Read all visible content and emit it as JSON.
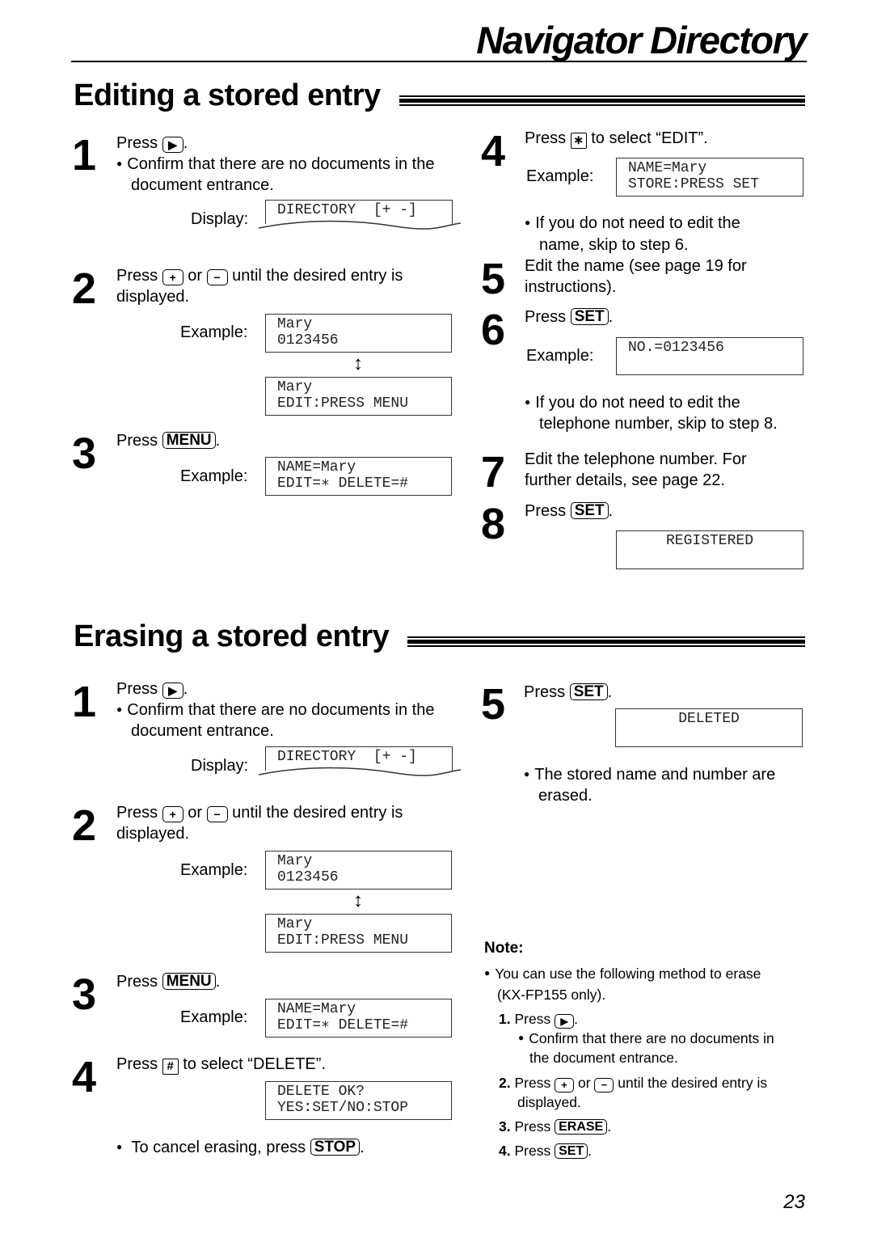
{
  "header": {
    "title": "Navigator Directory"
  },
  "editing": {
    "title": "Editing a stored entry",
    "steps": {
      "s1": {
        "num": "1",
        "press": "Press",
        "key": "play-key",
        "end": ".",
        "bullet": [
          "Confirm that there are no documents in the",
          "document entrance."
        ],
        "display_label": "Display:",
        "lcd": "DIRECTORY  [+ -]"
      },
      "s2": {
        "num": "2",
        "press": "Press",
        "or": "or",
        "rest": "until the desired entry is",
        "line2": "displayed.",
        "example_label": "Example:",
        "lcd1": [
          "Mary",
          "0123456"
        ],
        "lcd2": [
          "Mary",
          "EDIT:PRESS MENU"
        ]
      },
      "s3": {
        "num": "3",
        "press": "Press",
        "key": "MENU",
        "end": ".",
        "example_label": "Example:",
        "lcd": [
          "NAME=Mary",
          "EDIT=∗ DELETE=#"
        ]
      },
      "s4": {
        "num": "4",
        "press": "Press",
        "key": "∗",
        "rest": "to select “EDIT”.",
        "example_label": "Example:",
        "lcd": [
          "NAME=Mary",
          "STORE:PRESS SET"
        ],
        "bullet": [
          "If you do not need to edit the",
          "name, skip to step 6."
        ]
      },
      "s5": {
        "num": "5",
        "lines": [
          "Edit the name (see page 19 for",
          "instructions)."
        ]
      },
      "s6": {
        "num": "6",
        "press": "Press",
        "key": "SET",
        "end": ".",
        "example_label": "Example:",
        "lcd": "NO.=0123456",
        "bullet": [
          "If you do not need to edit the",
          "telephone number, skip to step 8."
        ]
      },
      "s7": {
        "num": "7",
        "lines": [
          "Edit the telephone number. For",
          "further details, see page 22."
        ]
      },
      "s8": {
        "num": "8",
        "press": "Press",
        "key": "SET",
        "end": ".",
        "lcd": "REGISTERED"
      }
    }
  },
  "erasing": {
    "title": "Erasing a stored entry",
    "steps": {
      "s1": {
        "num": "1",
        "press": "Press",
        "end": ".",
        "bullet": [
          "Confirm that there are no documents in the",
          "document entrance."
        ],
        "display_label": "Display:",
        "lcd": "DIRECTORY  [+ -]"
      },
      "s2": {
        "num": "2",
        "press": "Press",
        "or": "or",
        "rest": "until the desired entry is",
        "line2": "displayed.",
        "example_label": "Example:",
        "lcd1": [
          "Mary",
          "0123456"
        ],
        "lcd2": [
          "Mary",
          "EDIT:PRESS MENU"
        ]
      },
      "s3": {
        "num": "3",
        "press": "Press",
        "key": "MENU",
        "end": ".",
        "example_label": "Example:",
        "lcd": [
          "NAME=Mary",
          "EDIT=∗ DELETE=#"
        ]
      },
      "s4": {
        "num": "4",
        "press": "Press",
        "key": "#",
        "rest": "to select “DELETE”.",
        "lcd": [
          "DELETE OK?",
          "YES:SET/NO:STOP"
        ],
        "bullet_pre": "To cancel erasing, press",
        "bullet_key": "STOP",
        "bullet_end": "."
      },
      "s5": {
        "num": "5",
        "press": "Press",
        "key": "SET",
        "end": ".",
        "lcd": "DELETED",
        "bullet": [
          "The stored name and number are",
          "erased."
        ]
      }
    },
    "note": {
      "heading": "Note:",
      "bullet": [
        "You can use the following method to erase",
        "(KX-FP155 only)."
      ],
      "items": [
        {
          "num": "1.",
          "press": "Press",
          "end": ".",
          "sub": [
            "Confirm that there are no documents in",
            "the document entrance."
          ]
        },
        {
          "num": "2.",
          "press": "Press",
          "or": "or",
          "rest": "until the desired entry is",
          "line2": "displayed."
        },
        {
          "num": "3.",
          "press": "Press",
          "key": "ERASE",
          "end": "."
        },
        {
          "num": "4.",
          "press": "Press",
          "key": "SET",
          "end": "."
        }
      ]
    }
  },
  "keys": {
    "plus": "+",
    "minus": "−",
    "play": "▶",
    "updown": "↕"
  },
  "footer": {
    "page_number": "23"
  }
}
